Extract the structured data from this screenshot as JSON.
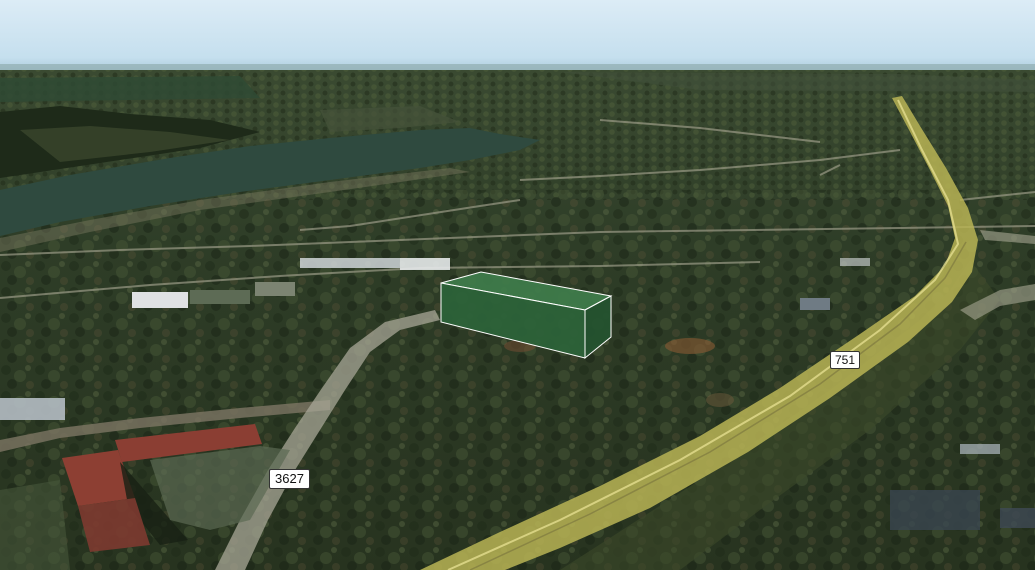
{
  "road_labels": {
    "highway": "751",
    "local_road": "3627"
  },
  "colors": {
    "sky": "#cfe6f3",
    "horizon": "#9ec1d3",
    "forest": "#2d3b25",
    "forest_light": "#4b5a36",
    "water": "#2f4a3f",
    "road_yellow": "#b8b455",
    "road_pale": "#b9b7a6",
    "parcel_box": "#2f6b3e",
    "parcel_edge": "#ffffff"
  },
  "icons": {
    "parcel_marker": "3d-parcel-box"
  }
}
